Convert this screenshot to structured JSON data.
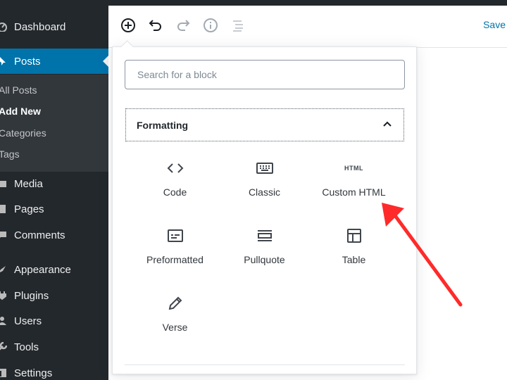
{
  "sidebar": {
    "items": [
      {
        "label": "Dashboard"
      },
      {
        "label": "Posts"
      },
      {
        "label": "Media"
      },
      {
        "label": "Pages"
      },
      {
        "label": "Comments"
      },
      {
        "label": "Appearance"
      },
      {
        "label": "Plugins"
      },
      {
        "label": "Users"
      },
      {
        "label": "Tools"
      },
      {
        "label": "Settings"
      }
    ],
    "posts_submenu": [
      "All Posts",
      "Add New",
      "Categories",
      "Tags"
    ],
    "active_item": "Posts",
    "current_subitem": "Add New"
  },
  "header": {
    "save_label": "Save"
  },
  "inserter": {
    "search_placeholder": "Search for a block",
    "panel_title": "Formatting",
    "blocks": [
      {
        "label": "Code",
        "icon": "code-icon"
      },
      {
        "label": "Classic",
        "icon": "keyboard-icon"
      },
      {
        "label": "Custom HTML",
        "icon": "html-icon",
        "icon_text": "HTML"
      },
      {
        "label": "Preformatted",
        "icon": "preformatted-icon"
      },
      {
        "label": "Pullquote",
        "icon": "pullquote-icon"
      },
      {
        "label": "Table",
        "icon": "table-icon"
      },
      {
        "label": "Verse",
        "icon": "pencil-icon"
      }
    ]
  },
  "colors": {
    "sidebar_bg": "#23282d",
    "submenu_bg": "#32373c",
    "accent": "#0073aa",
    "annotation_arrow": "#ff2a2a"
  }
}
